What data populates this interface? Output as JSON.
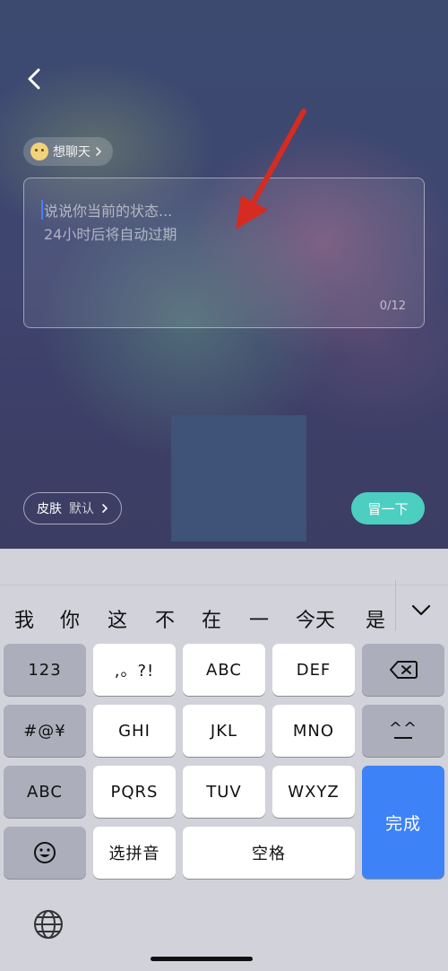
{
  "composer": {
    "mood_chip_label": "想聊天",
    "placeholder": "说说你当前的状态...\n24小时后将自动过期",
    "char_counter": "0/12",
    "skin_label": "皮肤",
    "skin_value": "默认",
    "submit_label": "冒一下"
  },
  "keyboard": {
    "candidates": [
      "我",
      "你",
      "这",
      "不",
      "在",
      "一",
      "今天",
      "是"
    ],
    "keys": {
      "num": "123",
      "punct": ",。?!",
      "abc1": "ABC",
      "def": "DEF",
      "symbols": "#@¥",
      "ghi": "GHI",
      "jkl": "JKL",
      "mno": "MNO",
      "kaomoji": "^^",
      "abc_switch": "ABC",
      "pqrs": "PQRS",
      "tuv": "TUV",
      "wxyz": "WXYZ",
      "done": "完成",
      "pinyin": "选拼音",
      "space": "空格"
    }
  },
  "colors": {
    "accent_teal": "#4ccfc0",
    "keyboard_done_blue": "#3d82f6",
    "annotation_red": "#d62b20"
  }
}
